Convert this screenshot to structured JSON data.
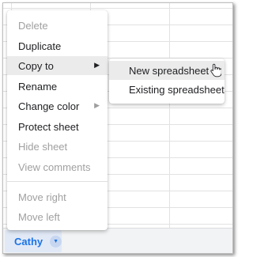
{
  "menu": {
    "items": [
      {
        "label": "Delete",
        "disabled": true
      },
      {
        "label": "Duplicate"
      },
      {
        "label": "Copy to",
        "submenu": true,
        "active": true
      },
      {
        "label": "Rename"
      },
      {
        "label": "Change color",
        "submenu": true
      },
      {
        "label": "Protect sheet"
      },
      {
        "label": "Hide sheet",
        "disabled": true
      },
      {
        "label": "View comments",
        "disabled": true
      },
      {
        "label": "Move right",
        "disabled": true
      },
      {
        "label": "Move left",
        "disabled": true
      }
    ]
  },
  "submenu": {
    "items": [
      {
        "label": "New spreadsheet",
        "hovered": true
      },
      {
        "label": "Existing spreadsheet"
      }
    ]
  },
  "sheet_tab": {
    "name": "Cathy",
    "icon": "chevron-down-icon"
  },
  "colors": {
    "tab_text": "#1a73e8",
    "tab_bg": "#e1e9f7",
    "disabled_text": "#a0a0a0",
    "highlight": "#ebebeb"
  }
}
